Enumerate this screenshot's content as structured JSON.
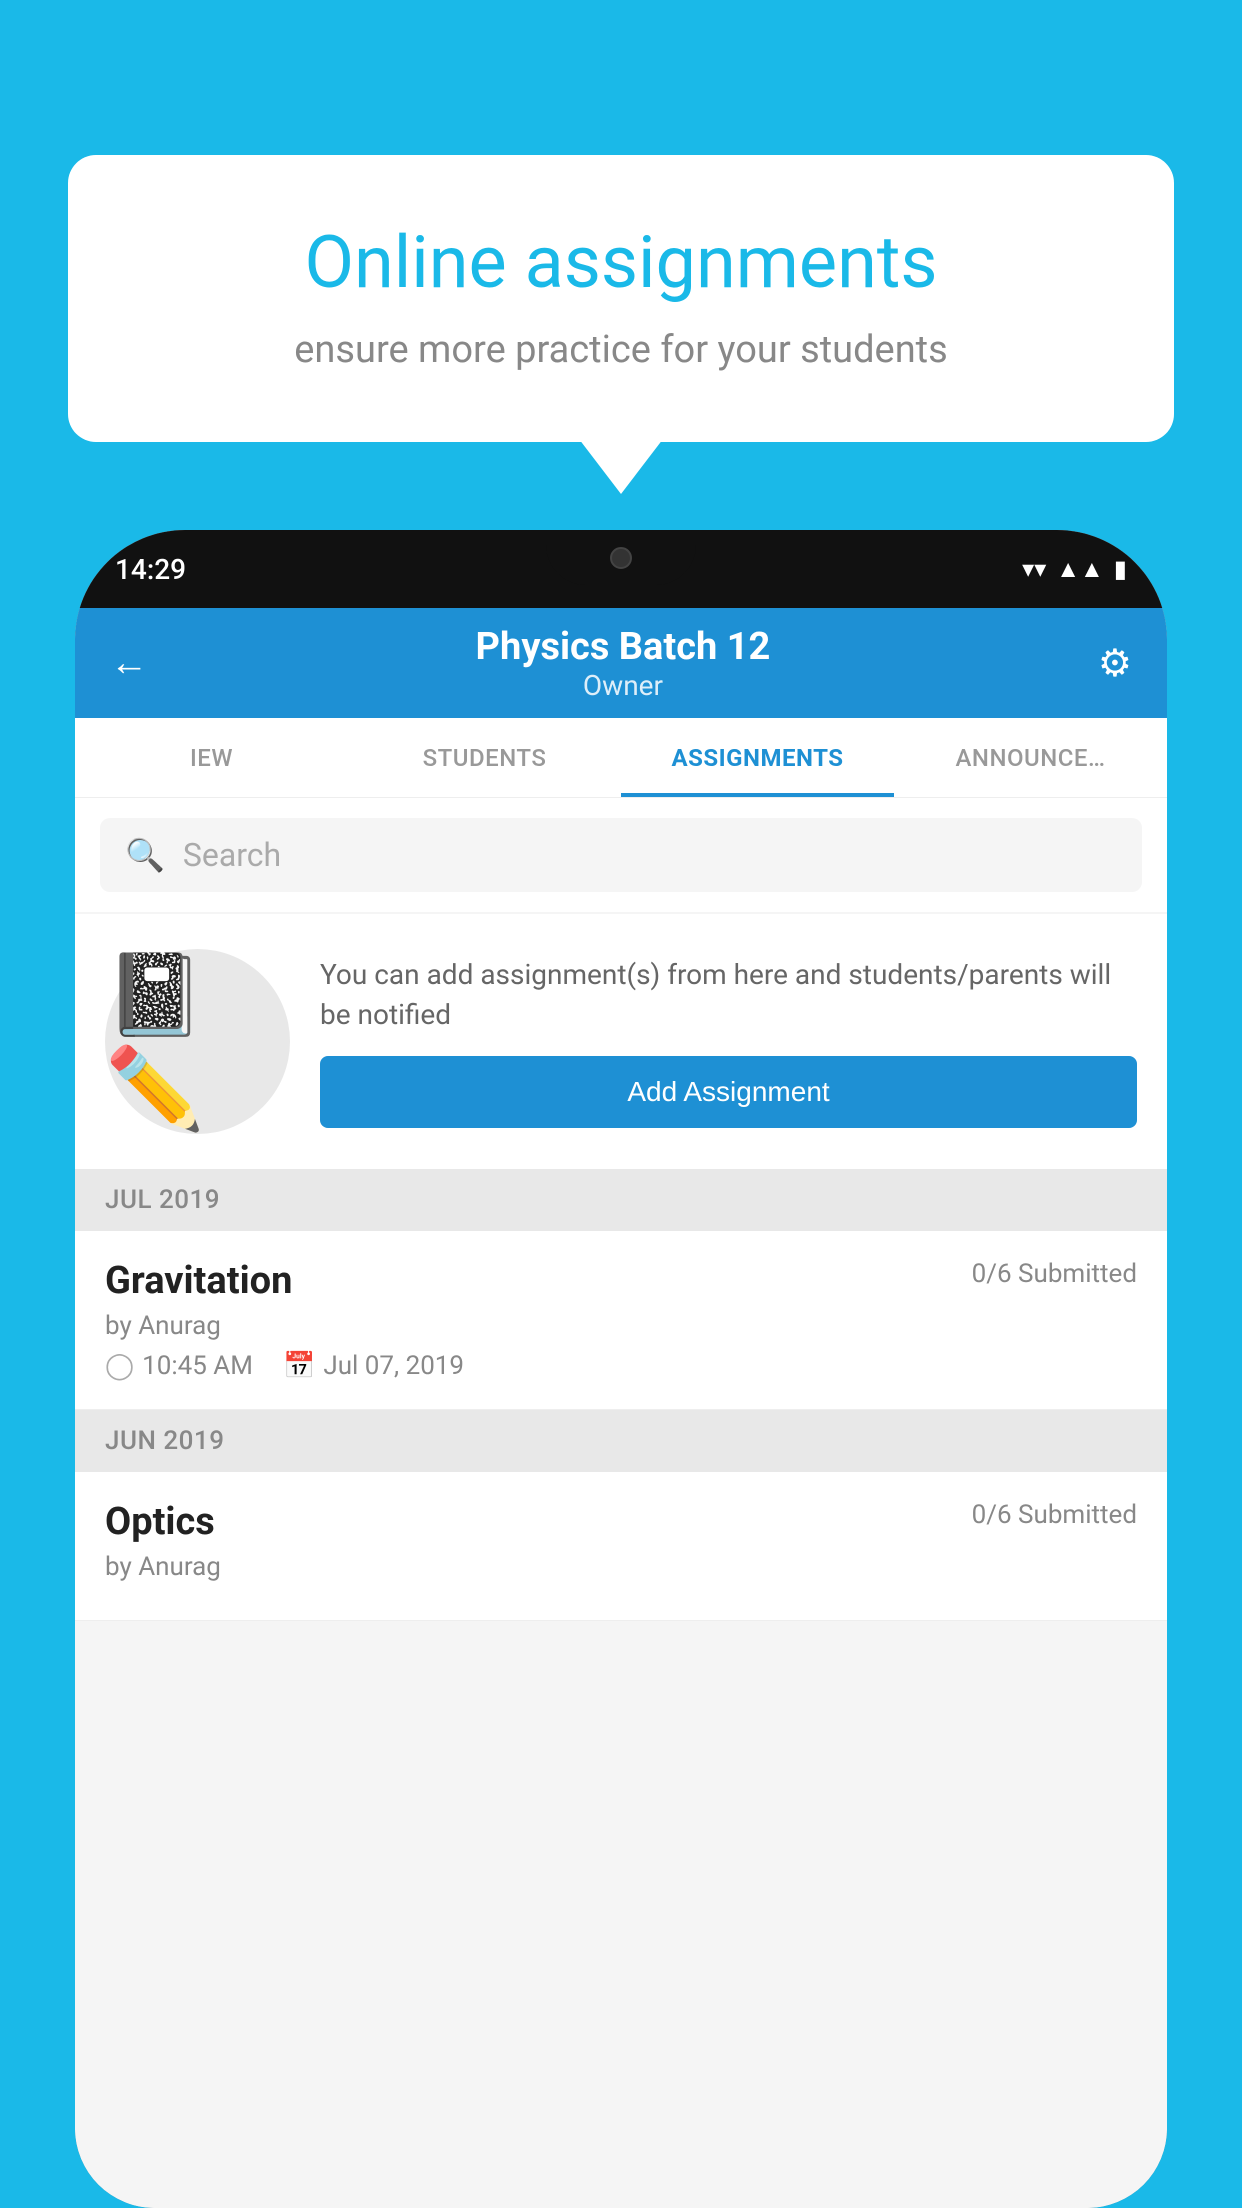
{
  "background_color": "#1ab9e8",
  "speech_bubble": {
    "title": "Online assignments",
    "subtitle": "ensure more practice for your students"
  },
  "phone": {
    "status_bar": {
      "time": "14:29"
    },
    "header": {
      "title": "Physics Batch 12",
      "subtitle": "Owner"
    },
    "tabs": [
      {
        "label": "IEW",
        "active": false
      },
      {
        "label": "STUDENTS",
        "active": false
      },
      {
        "label": "ASSIGNMENTS",
        "active": true
      },
      {
        "label": "ANNOUNCEMENTS",
        "active": false
      }
    ],
    "search": {
      "placeholder": "Search"
    },
    "promo": {
      "description": "You can add assignment(s) from here and students/parents will be notified",
      "button_label": "Add Assignment"
    },
    "sections": [
      {
        "month": "JUL 2019",
        "assignments": [
          {
            "title": "Gravitation",
            "submitted": "0/6 Submitted",
            "author": "by Anurag",
            "time": "10:45 AM",
            "date": "Jul 07, 2019"
          }
        ]
      },
      {
        "month": "JUN 2019",
        "assignments": [
          {
            "title": "Optics",
            "submitted": "0/6 Submitted",
            "author": "by Anurag",
            "time": "",
            "date": ""
          }
        ]
      }
    ]
  }
}
